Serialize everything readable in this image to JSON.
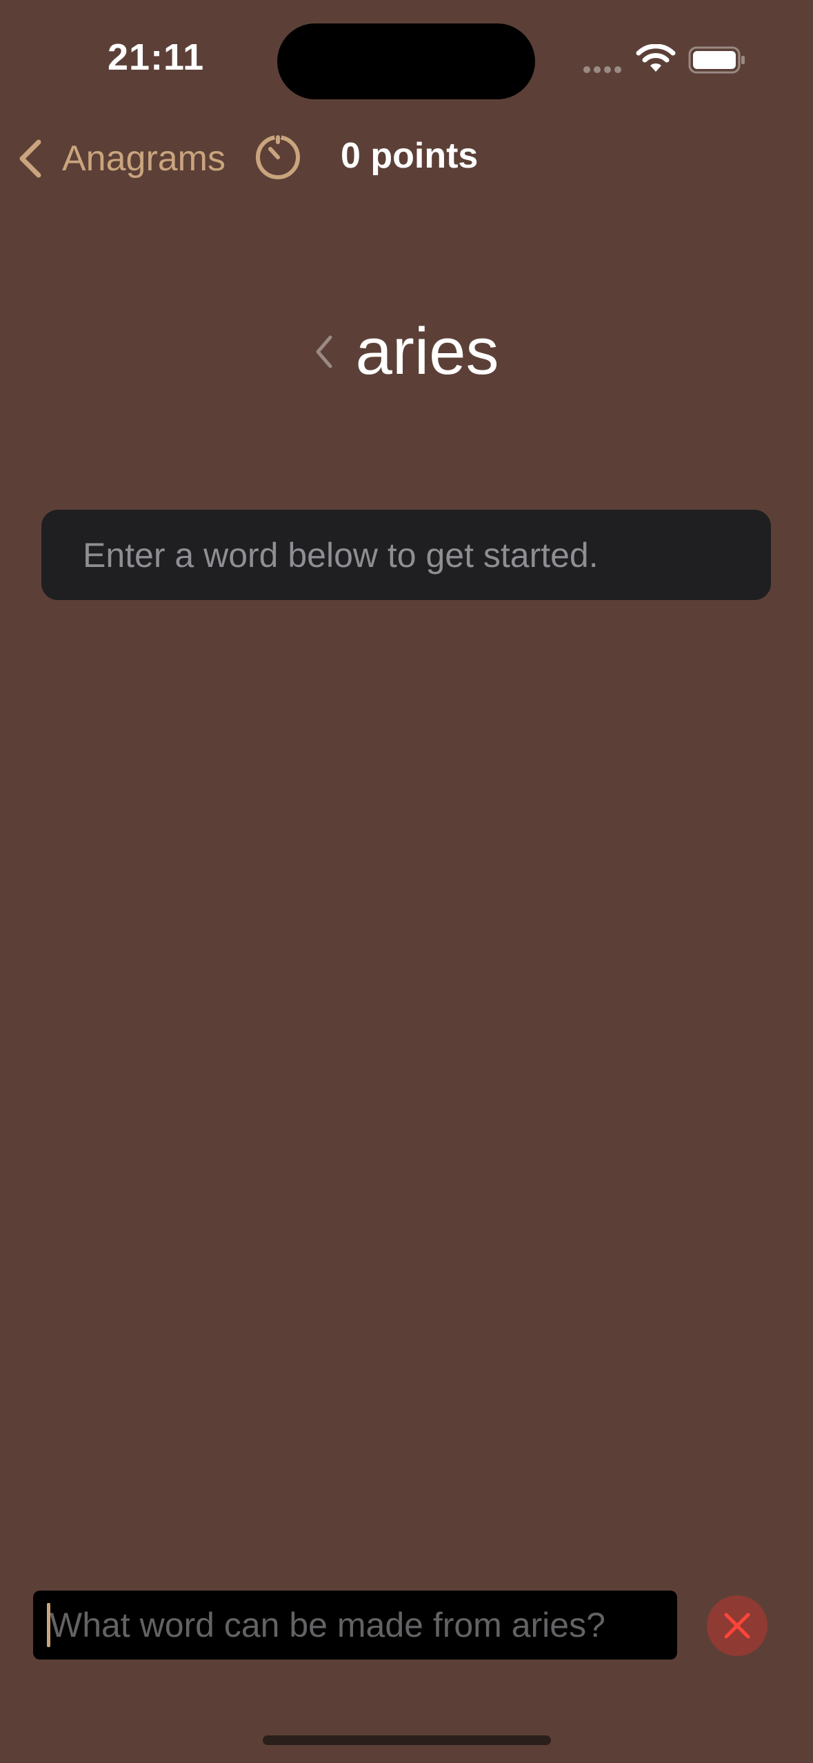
{
  "status_bar": {
    "time": "21:11",
    "icons": [
      "cellular-signal-icon",
      "wifi-icon",
      "battery-icon"
    ]
  },
  "nav": {
    "back_label": "Anagrams",
    "back_icon": "chevron-left-icon",
    "timer_icon": "timer-icon",
    "points": "0 points"
  },
  "game": {
    "base_word": "aries",
    "prev_icon": "chevron-left-icon",
    "hint": "Enter a word below to get started."
  },
  "input": {
    "value": "",
    "placeholder": "What word can be made from aries?",
    "clear_icon": "close-icon"
  },
  "colors": {
    "background": "#5c4037",
    "accent": "#c9a47e",
    "card": "#1f1e21",
    "clear_button": "#8f3a33",
    "clear_x": "#ff453a"
  }
}
